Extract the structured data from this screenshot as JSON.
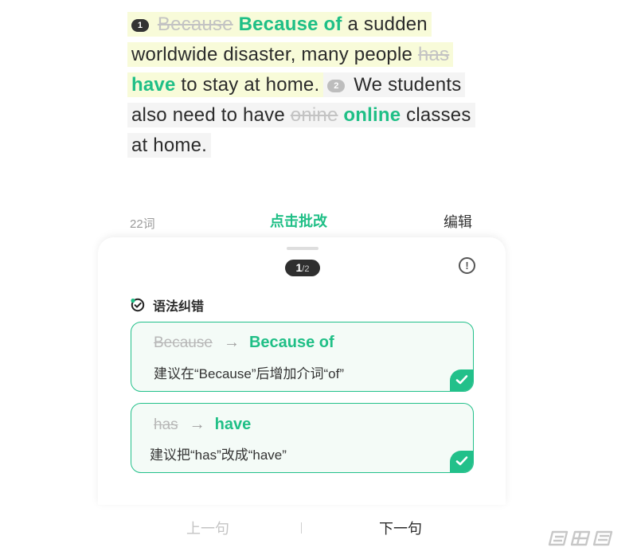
{
  "essay": {
    "marker_1": "1",
    "line1": {
      "wrong": "Because",
      "fix": "Because of",
      "rest": "a sudden"
    },
    "line2": {
      "text": "worldwide disaster, many people",
      "wrong": "has"
    },
    "line3": {
      "fix": "have",
      "text": "to stay at home.",
      "marker_2": "2",
      "text2": "We students"
    },
    "line4": {
      "text": "also need to have",
      "wrong": "onine",
      "fix": "online",
      "rest": "classes"
    },
    "line5": {
      "text": "at home."
    }
  },
  "toolbar": {
    "word_count": "22词",
    "check_label": "点击批改",
    "edit_label": "编辑"
  },
  "sheet": {
    "pager": {
      "current": "1",
      "separator": "/",
      "total": "2"
    },
    "info_icon": "!",
    "section_title": "语法纠错",
    "cards": [
      {
        "from": "Because",
        "to": "Because of",
        "suggestion": "建议在“Because”后增加介词“of”"
      },
      {
        "from": "has",
        "to": "have",
        "suggestion": "建议把“has”改成“have”"
      }
    ],
    "arrow": "→"
  },
  "footer": {
    "prev_label": "上一句",
    "next_label": "下一句"
  },
  "colors": {
    "accent_green": "#1fbf86",
    "highlight_yellow": "#f8fbd9",
    "highlight_gray": "#f4f4f4",
    "pager_bg": "#2f2f2f"
  },
  "icons": {
    "grammar": "grammar-check-icon",
    "info": "info-icon",
    "check": "check-icon",
    "watermark": "watermark-logo"
  }
}
